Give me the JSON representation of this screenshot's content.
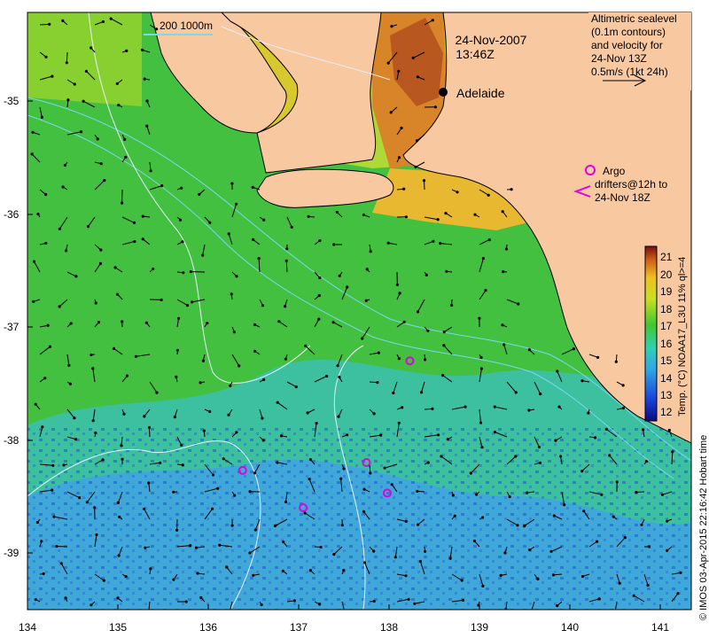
{
  "axes": {
    "y_ticks": [
      "-35",
      "-36",
      "-37",
      "-38",
      "-39"
    ],
    "x_ticks": [
      "134",
      "135",
      "136",
      "137",
      "138",
      "139",
      "140",
      "141"
    ]
  },
  "scale_bar": {
    "label": "200  1000m"
  },
  "datetime": {
    "date": "24-Nov-2007",
    "time": "13:46Z"
  },
  "city": {
    "name": "Adelaide"
  },
  "velocity_legend": {
    "lines": [
      "Altimetric sealevel",
      "(0.1m contours)",
      "and velocity for",
      "24-Nov 13Z",
      "0.5m/s (1kt 24h)"
    ]
  },
  "argo_legend": {
    "lines": [
      "Argo",
      "drifters@12h to",
      "24-Nov 18Z"
    ],
    "color": "#e000e0",
    "floats": [
      {
        "lon": 138.23,
        "lat": -37.3
      },
      {
        "lon": 137.75,
        "lat": -38.2
      },
      {
        "lon": 136.38,
        "lat": -38.27
      },
      {
        "lon": 137.98,
        "lat": -38.47
      },
      {
        "lon": 137.05,
        "lat": -38.6
      }
    ]
  },
  "colorbar": {
    "title": "Temp. (°C) NOAA17_L3U 11% ql>=4",
    "ticks": [
      "21",
      "20",
      "19",
      "18",
      "17",
      "16",
      "15",
      "14",
      "13",
      "12"
    ]
  },
  "credit": {
    "text": "© IMOS 03-Apr-2015 22:16:42 Hobart time"
  },
  "colors": {
    "land": "#f8c8a0",
    "warm": "#c86428",
    "mid": "#50c828",
    "cool": "#3c9cd0",
    "contour": "#e8f0ff",
    "isobath": "#7ad8f0"
  }
}
